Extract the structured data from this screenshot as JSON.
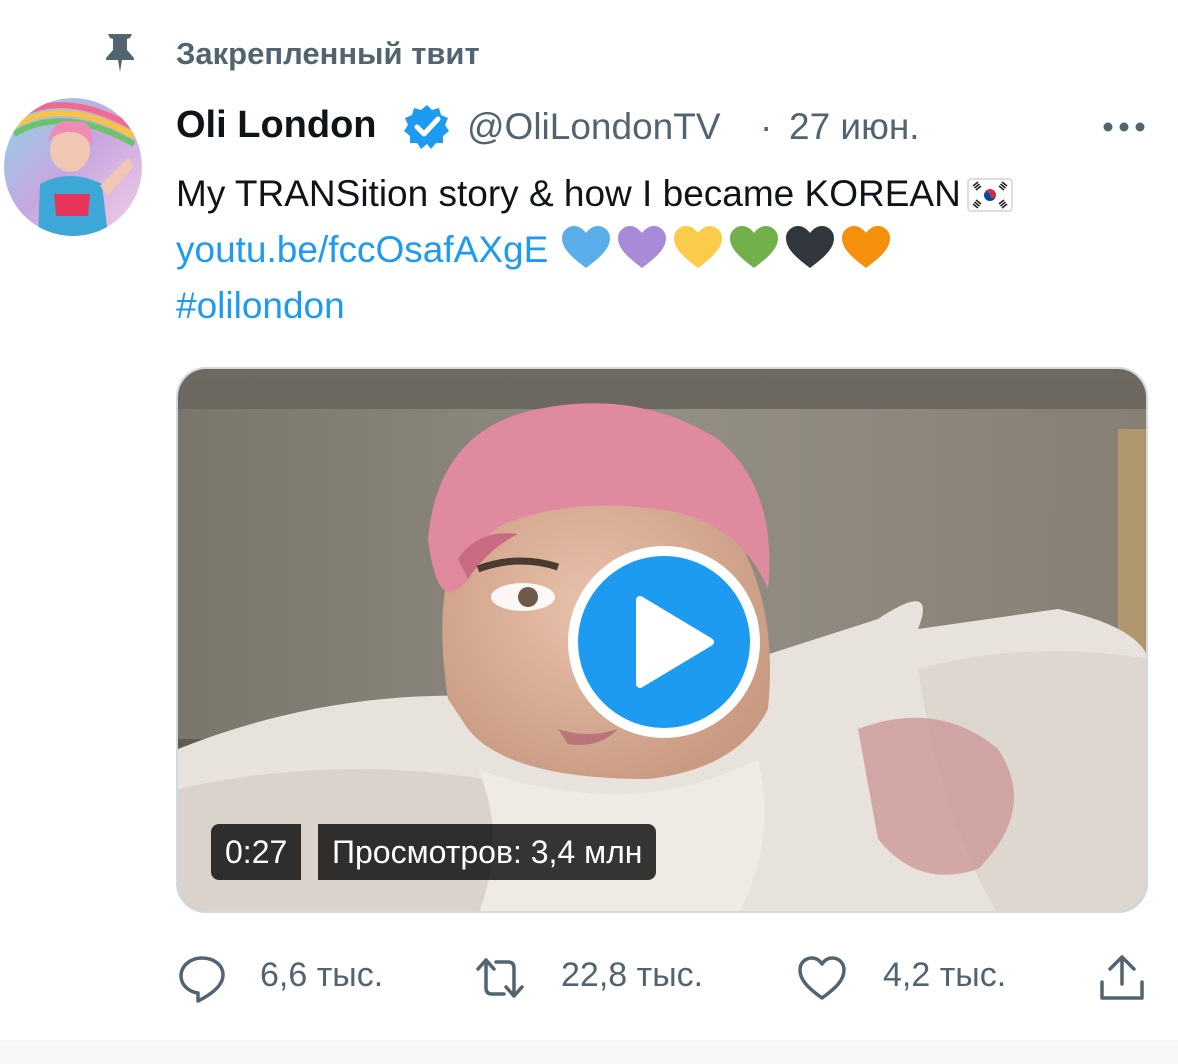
{
  "pinned": {
    "label": "Закрепленный твит",
    "icon": "pin-icon"
  },
  "tweet": {
    "author": {
      "name": "Oli London",
      "handle": "@OliLondonTV",
      "verified": true,
      "avatar_icon": "avatar"
    },
    "separator": "·",
    "date": "27 июн.",
    "text": {
      "line1": "My TRANSition story & how I became KOREAN",
      "flag_icon": "south-korea-flag-icon",
      "link": "youtu.be/fccOsafAXgE",
      "hearts": [
        {
          "icon": "blue-heart-icon",
          "color": "#5aaeea"
        },
        {
          "icon": "purple-heart-icon",
          "color": "#a98ad9"
        },
        {
          "icon": "yellow-heart-icon",
          "color": "#fbcc4a"
        },
        {
          "icon": "green-heart-icon",
          "color": "#72b04c"
        },
        {
          "icon": "black-heart-icon",
          "color": "#31373d"
        },
        {
          "icon": "orange-heart-icon",
          "color": "#f4900c"
        }
      ],
      "hashtag": "#olilondon"
    },
    "media": {
      "duration": "0:27",
      "views": "Просмотров: 3,4 млн",
      "play_color": "#1d9bf0"
    },
    "actions": {
      "replies": "6,6 тыс.",
      "retweets": "22,8 тыс.",
      "likes": "4,2 тыс."
    }
  },
  "colors": {
    "accent": "#1d9bf0",
    "secondary_text": "#536471",
    "primary_text": "#0f1419"
  }
}
